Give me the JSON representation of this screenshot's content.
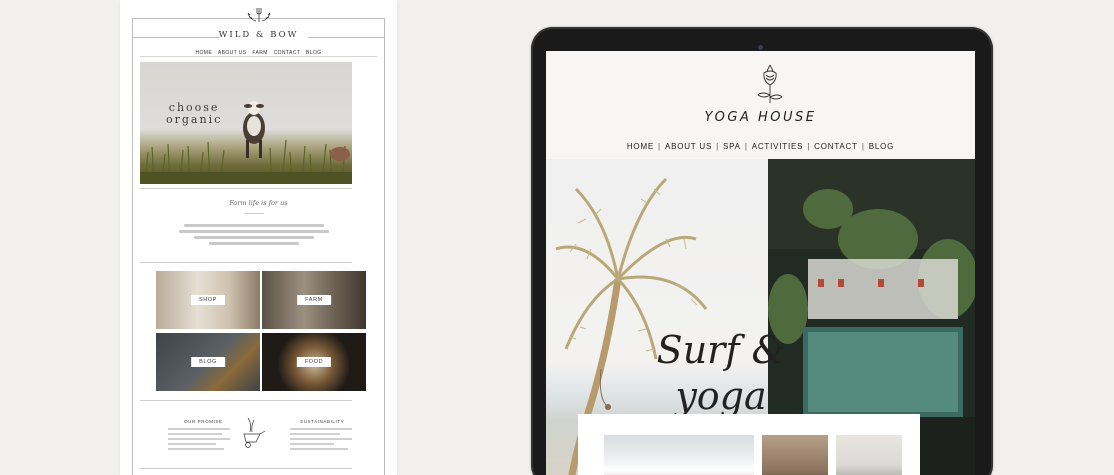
{
  "left_site": {
    "brand": "WILD & BOW",
    "nav": [
      "HOME",
      "ABOUT US",
      "FARM",
      "CONTACT",
      "BLOG"
    ],
    "hero_text_line1": "choose",
    "hero_text_line2": "organic",
    "subtitle": "Farm life is for us",
    "tiles": [
      "SHOP",
      "FARM",
      "BLOG",
      "FOOD"
    ],
    "footer_col_left": "OUR PROMISE",
    "footer_col_right": "SUSTAINABILITY"
  },
  "tablet_site": {
    "brand": "YOGA HOUSE",
    "nav": [
      "HOME",
      "ABOUT US",
      "SPA",
      "ACTIVITIES",
      "CONTACT",
      "BLOG"
    ],
    "script_line1": "Surf &",
    "script_line2": "yoga"
  },
  "colors": {
    "background": "#f1f0ee",
    "tablet_frame": "#1a1a1a",
    "screen_bg": "#f7f6f4"
  }
}
